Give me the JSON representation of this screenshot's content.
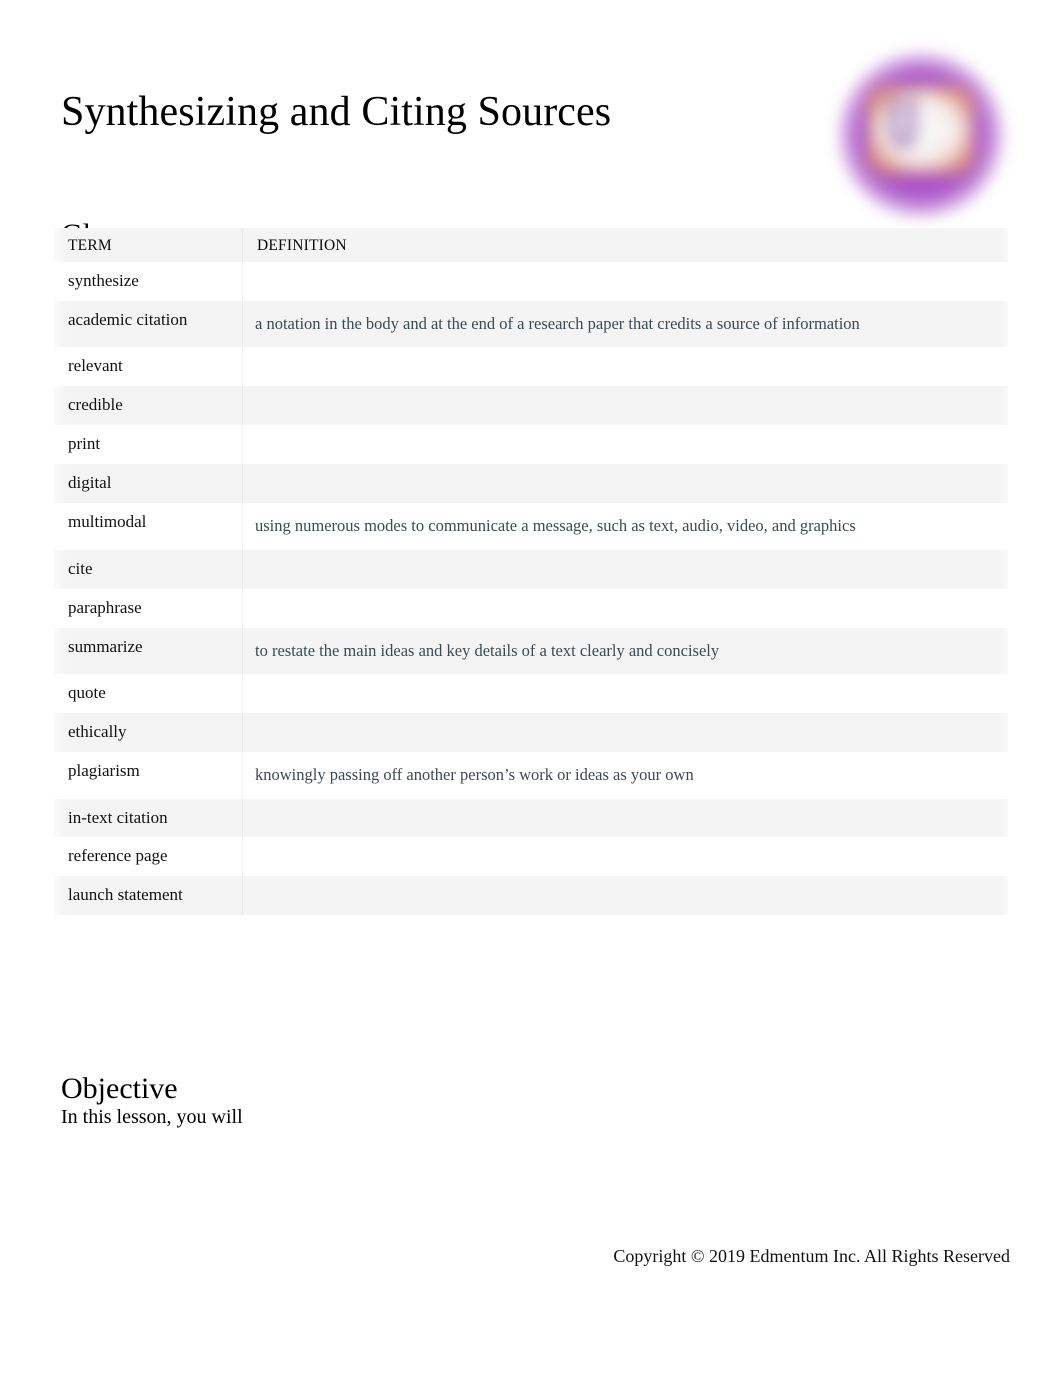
{
  "document": {
    "title": "Synthesizing and Citing Sources"
  },
  "logo": {
    "icon": "edmentum-circle-logo",
    "circle_color": "#a850c6",
    "plate_color": "#f6f0ee",
    "accent_color": "#e2966a"
  },
  "glossary": {
    "heading": "Glossary",
    "columns": [
      "TERM",
      "DEFINITION"
    ],
    "rows": [
      {
        "term": "synthesize",
        "definition": ""
      },
      {
        "term": "academic citation",
        "definition": "a notation in the body and at the end of a research paper that credits a source of information"
      },
      {
        "term": "relevant",
        "definition": ""
      },
      {
        "term": "credible",
        "definition": ""
      },
      {
        "term": "print",
        "definition": ""
      },
      {
        "term": "digital",
        "definition": ""
      },
      {
        "term": "multimodal",
        "definition": "using numerous modes to communicate a message, such as text, audio, video, and graphics"
      },
      {
        "term": "cite",
        "definition": ""
      },
      {
        "term": "paraphrase",
        "definition": ""
      },
      {
        "term": "summarize",
        "definition": "to restate the main ideas and key details of a text clearly and concisely"
      },
      {
        "term": "quote",
        "definition": ""
      },
      {
        "term": "ethically",
        "definition": ""
      },
      {
        "term": "plagiarism",
        "definition": "knowingly passing off another     person’s work or ideas as your own"
      },
      {
        "term": "in-text citation",
        "definition": ""
      },
      {
        "term": "reference page",
        "definition": ""
      },
      {
        "term": "launch statement",
        "definition": ""
      }
    ]
  },
  "objective": {
    "heading": "Objective",
    "text": "In this lesson, you will"
  },
  "footer": {
    "copyright": "Copyright © 2019 Edmentum Inc. All Rights Reserved"
  }
}
